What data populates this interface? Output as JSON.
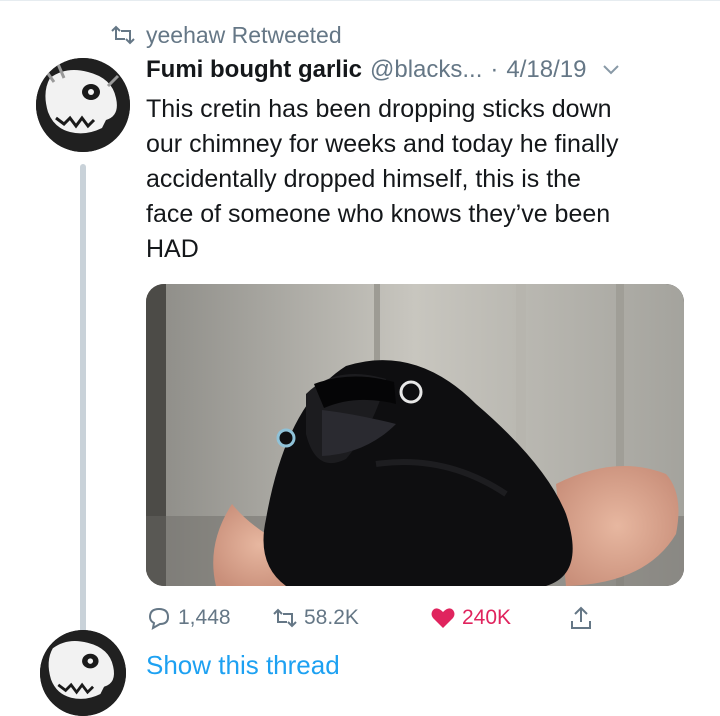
{
  "retweet": {
    "label": "yeehaw Retweeted",
    "icon": "retweet-icon"
  },
  "tweet": {
    "display_name": "Fumi bought garlic",
    "handle": "@blacks...",
    "separator": "·",
    "date": "4/18/19",
    "text_lines": [
      "This cretin has been dropping sticks down",
      "our chimney for weeks and today he finally",
      "accidentally dropped himself, this is the",
      "face of someone who knows they’ve been",
      "HAD"
    ]
  },
  "actions": {
    "reply_count": "1,448",
    "retweet_count": "58.2K",
    "like_count": "240K"
  },
  "show_thread": {
    "label": "Show this thread"
  },
  "colors": {
    "text": "#14171a",
    "secondary": "#657786",
    "link": "#1da1f2",
    "like": "#e0245e",
    "thread_line": "#c9d2d9"
  }
}
